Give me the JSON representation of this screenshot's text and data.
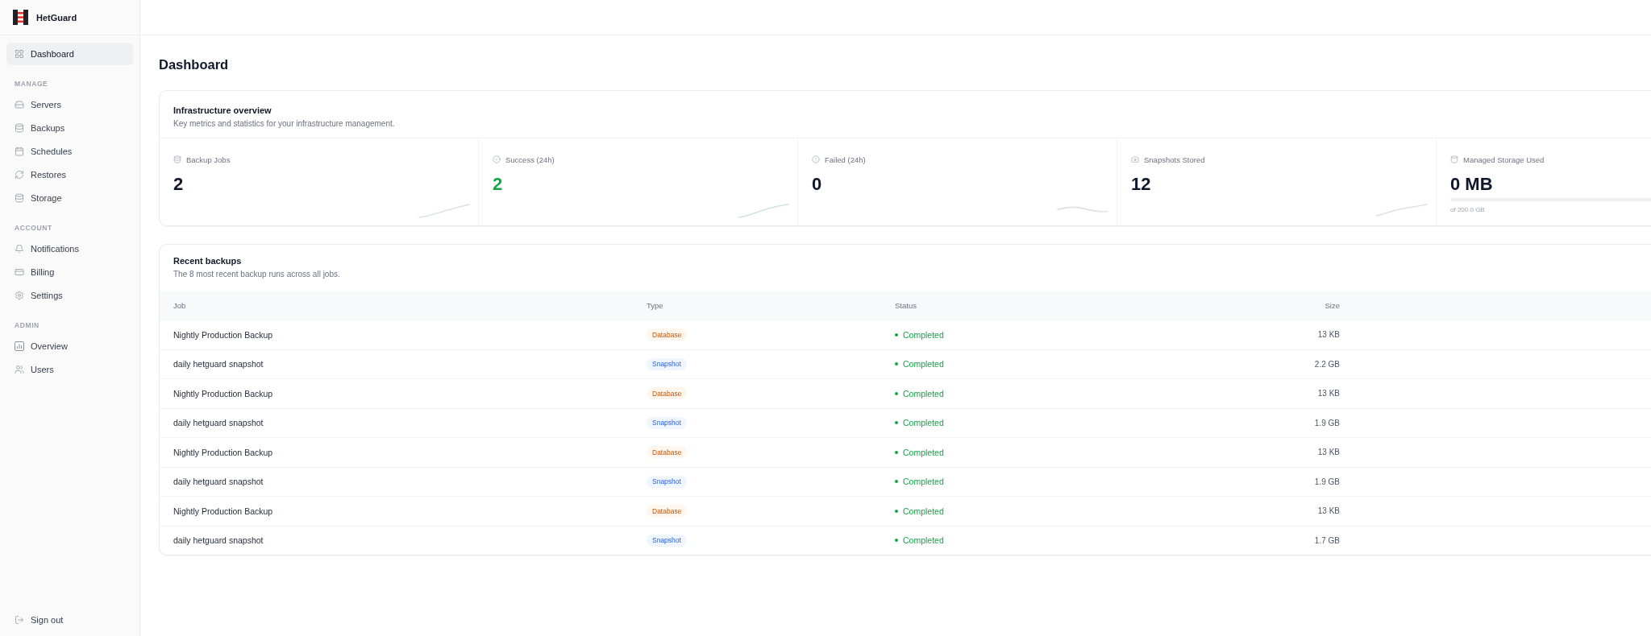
{
  "sidebar": {
    "brand": "HetGuard",
    "items": [
      {
        "label": "Dashboard",
        "selected": true
      }
    ],
    "sections": [
      {
        "title": "MANAGE",
        "items": [
          {
            "label": "Servers",
            "selected": false
          },
          {
            "label": "Backups",
            "selected": false
          },
          {
            "label": "Schedules",
            "selected": false
          },
          {
            "label": "Restores",
            "selected": false
          },
          {
            "label": "Storage",
            "selected": false
          }
        ]
      },
      {
        "title": "ACCOUNT",
        "items": [
          {
            "label": "Notifications",
            "selected": false
          },
          {
            "label": "Billing",
            "selected": false
          },
          {
            "label": "Settings",
            "selected": false
          }
        ]
      },
      {
        "title": "ADMIN",
        "items": [
          {
            "label": "Overview",
            "selected": false
          },
          {
            "label": "Users",
            "selected": false
          }
        ]
      }
    ],
    "footer": {
      "label": "Sign out"
    }
  },
  "page": {
    "title": "Dashboard"
  },
  "overview": {
    "title": "Infrastructure overview",
    "subtitle": "Key metrics and statistics for your infrastructure management.",
    "stats": [
      {
        "kind": "count",
        "label": "Backup Jobs",
        "value": "2"
      },
      {
        "kind": "success",
        "label": "Success (24h)",
        "value": "2"
      },
      {
        "kind": "count",
        "label": "Failed (24h)",
        "value": "0"
      },
      {
        "kind": "count",
        "label": "Snapshots Stored",
        "value": "12"
      },
      {
        "kind": "meter",
        "label": "Managed Storage Used",
        "value": "0 MB",
        "level": 0,
        "caption": "of 200.0 GB"
      }
    ]
  },
  "recent_backups": {
    "title": "Recent backups",
    "subtitle": "The 8 most recent backup runs across all jobs.",
    "columns": [
      "Job",
      "Type",
      "Status",
      "Size"
    ],
    "rows": [
      {
        "job": "Nightly Production Backup",
        "type": {
          "label": "Database",
          "kind": "database"
        },
        "status": {
          "label": "Completed",
          "kind": "completed"
        },
        "size": "13 KB"
      },
      {
        "job": "daily hetguard snapshot",
        "type": {
          "label": "Snapshot",
          "kind": "snapshot"
        },
        "status": {
          "label": "Completed",
          "kind": "completed"
        },
        "size": "2.2 GB"
      },
      {
        "job": "Nightly Production Backup",
        "type": {
          "label": "Database",
          "kind": "database"
        },
        "status": {
          "label": "Completed",
          "kind": "completed"
        },
        "size": "13 KB"
      },
      {
        "job": "daily hetguard snapshot",
        "type": {
          "label": "Snapshot",
          "kind": "snapshot"
        },
        "status": {
          "label": "Completed",
          "kind": "completed"
        },
        "size": "1.9 GB"
      },
      {
        "job": "Nightly Production Backup",
        "type": {
          "label": "Database",
          "kind": "database"
        },
        "status": {
          "label": "Completed",
          "kind": "completed"
        },
        "size": "13 KB"
      },
      {
        "job": "daily hetguard snapshot",
        "type": {
          "label": "Snapshot",
          "kind": "snapshot"
        },
        "status": {
          "label": "Completed",
          "kind": "completed"
        },
        "size": "1.9 GB"
      },
      {
        "job": "Nightly Production Backup",
        "type": {
          "label": "Database",
          "kind": "database"
        },
        "status": {
          "label": "Completed",
          "kind": "completed"
        },
        "size": "13 KB"
      },
      {
        "job": "daily hetguard snapshot",
        "type": {
          "label": "Snapshot",
          "kind": "snapshot"
        },
        "status": {
          "label": "Completed",
          "kind": "completed"
        },
        "size": "1.7 GB"
      }
    ]
  }
}
